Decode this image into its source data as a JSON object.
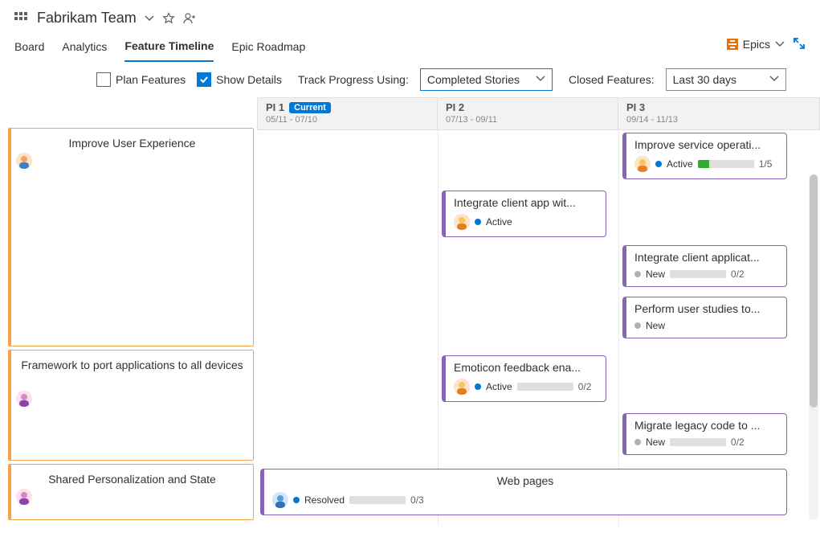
{
  "header": {
    "team_name": "Fabrikam Team"
  },
  "tabs": {
    "board": "Board",
    "analytics": "Analytics",
    "feature_timeline": "Feature Timeline",
    "epic_roadmap": "Epic Roadmap",
    "epics_button": "Epics"
  },
  "toolbar": {
    "plan_features": "Plan Features",
    "show_details": "Show Details",
    "track_label": "Track Progress Using:",
    "track_value": "Completed Stories",
    "closed_label": "Closed Features:",
    "closed_value": "Last 30 days"
  },
  "columns": {
    "pi1": {
      "name": "PI 1",
      "badge": "Current",
      "dates": "05/11 - 07/10"
    },
    "pi2": {
      "name": "PI 2",
      "dates": "07/13 - 09/11"
    },
    "pi3": {
      "name": "PI 3",
      "dates": "09/14 - 11/13"
    }
  },
  "epics": {
    "e1": {
      "title": "Improve User Experience"
    },
    "e2": {
      "title": "Framework to port applications to all devices"
    },
    "e3": {
      "title": "Shared Personalization and State"
    }
  },
  "features": {
    "f_improve_service": {
      "title": "Improve service operati...",
      "state": "Active",
      "progress": "1/5"
    },
    "f_integrate_pi2": {
      "title": "Integrate client app wit...",
      "state": "Active"
    },
    "f_integrate_pi3": {
      "title": "Integrate client applicat...",
      "state": "New",
      "progress": "0/2"
    },
    "f_perform_user": {
      "title": "Perform user studies to...",
      "state": "New"
    },
    "f_emoticon": {
      "title": "Emoticon feedback ena...",
      "state": "Active",
      "progress": "0/2"
    },
    "f_migrate": {
      "title": "Migrate legacy code to ...",
      "state": "New",
      "progress": "0/2"
    },
    "f_web_pages": {
      "title": "Web pages",
      "state": "Resolved",
      "progress": "0/3"
    }
  }
}
